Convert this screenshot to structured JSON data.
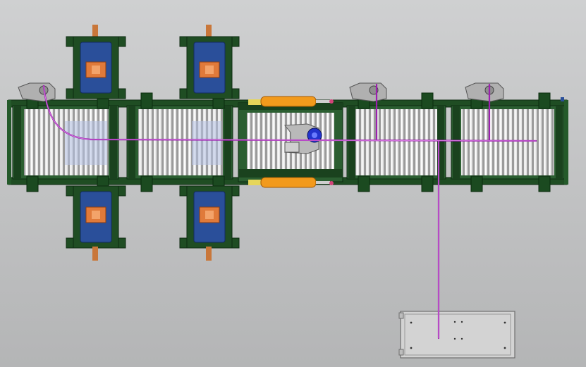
{
  "view": {
    "type": "CAD top view",
    "background": "#c2c3c4"
  },
  "colors": {
    "frame": "#1f4d23",
    "frame_light": "#2f6b35",
    "roller": "#d8d8d8",
    "roller_dark": "#8a8a8a",
    "motor": "#2a4f9a",
    "motor_plate": "#e07a3a",
    "shaft": "#c9773a",
    "cylinder": "#f29a1c",
    "cable": "#9c1fb0",
    "cabinet": "#d3d3d3",
    "glass": "#b7c2e6",
    "grey_part": "#b9b9b9"
  },
  "components": {
    "conveyor_sections": 5,
    "motor_units": 4,
    "pneumatic_cylinders": 2,
    "sensors": 3,
    "control_cabinet": 1
  }
}
